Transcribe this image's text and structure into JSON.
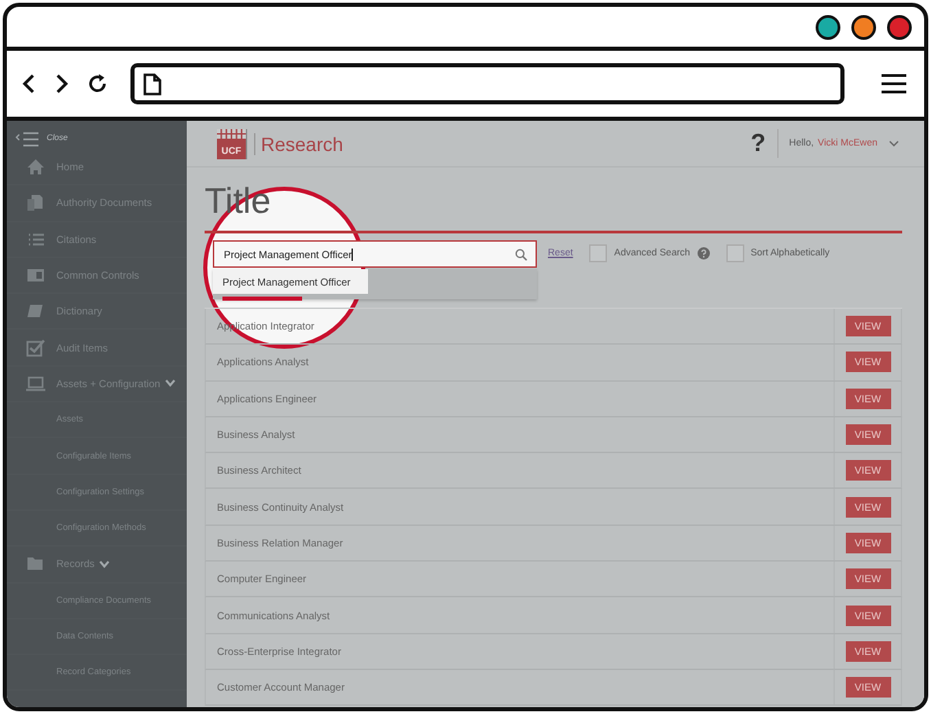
{
  "browser": {
    "dots": [
      {
        "color": "#19aaa3"
      },
      {
        "color": "#f07d22"
      },
      {
        "color": "#d9202a"
      }
    ]
  },
  "sidebar": {
    "close_label": "Close",
    "items": [
      {
        "label": "Home"
      },
      {
        "label": "Authority Documents"
      },
      {
        "label": "Citations"
      },
      {
        "label": "Common Controls"
      },
      {
        "label": "Dictionary"
      },
      {
        "label": "Audit Items"
      },
      {
        "label": "Assets + Configuration",
        "expanded": true,
        "children": [
          {
            "label": "Assets"
          },
          {
            "label": "Configurable Items"
          },
          {
            "label": "Configuration Settings"
          },
          {
            "label": "Configuration Methods"
          }
        ]
      },
      {
        "label": "Records",
        "expanded": true,
        "children": [
          {
            "label": "Compliance Documents"
          },
          {
            "label": "Data Contents"
          },
          {
            "label": "Record Categories"
          }
        ]
      }
    ]
  },
  "header": {
    "logo_text": "UCF",
    "brand": "Research",
    "help": "?",
    "greeting": "Hello,",
    "user": "Vicki McEwen"
  },
  "page_title": "Title",
  "search": {
    "value": "Project Management Officer",
    "suggestions": [
      "Project Management Officer"
    ],
    "reset": "Reset",
    "options": [
      {
        "label": "Advanced Search",
        "checked": false,
        "kind": "with_help"
      },
      {
        "label": "Sort Alphabetically",
        "checked": false,
        "kind": "plain"
      }
    ]
  },
  "rows": [
    {
      "name": "Application Integrator",
      "action": "VIEW"
    },
    {
      "name": "Applications Analyst",
      "action": "VIEW"
    },
    {
      "name": "Applications Engineer",
      "action": "VIEW"
    },
    {
      "name": "Business Analyst",
      "action": "VIEW"
    },
    {
      "name": "Business Architect",
      "action": "VIEW"
    },
    {
      "name": "Business Continuity Analyst",
      "action": "VIEW"
    },
    {
      "name": "Business Relation Manager",
      "action": "VIEW"
    },
    {
      "name": "Computer Engineer",
      "action": "VIEW"
    },
    {
      "name": "Communications Analyst",
      "action": "VIEW"
    },
    {
      "name": "Cross-Enterprise Integrator",
      "action": "VIEW"
    },
    {
      "name": "Customer Account Manager",
      "action": "VIEW"
    }
  ]
}
